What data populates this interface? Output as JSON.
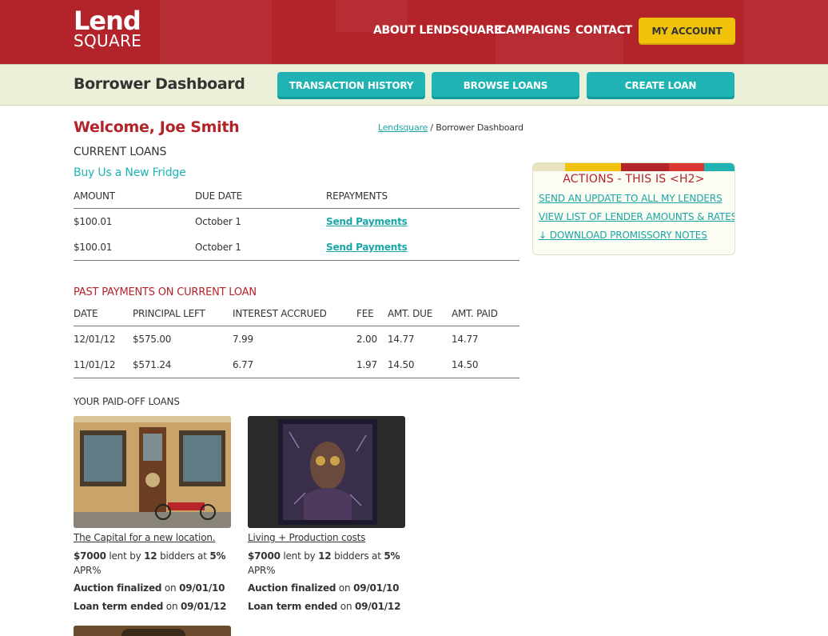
{
  "brand": {
    "logo_line1": "Lend",
    "logo_line2": "SQUARE"
  },
  "topnav": {
    "about": "ABOUT LENDSQUARE",
    "campaigns": "CAMPAIGNS",
    "contact": "CONTACT",
    "account": "MY ACCOUNT"
  },
  "subheader": {
    "title": "Borrower Dashboard",
    "btn_history": "TRANSACTION HISTORY",
    "btn_browse": "BROWSE LOANS",
    "btn_create": "CREATE LOAN"
  },
  "welcome": "Welcome, Joe Smith",
  "breadcrumb": {
    "home": "Lendsquare",
    "sep": " / ",
    "current": "Borrower Dashboard"
  },
  "current_loans": {
    "heading": "CURRENT LOANS",
    "loan_name": "Buy Us a New Fridge",
    "columns": [
      "AMOUNT",
      "DUE DATE",
      "REPAYMENTS"
    ],
    "rows": [
      {
        "amount": "$100.01",
        "due": "October 1",
        "action": "Send Payments"
      },
      {
        "amount": "$100.01",
        "due": "October 1",
        "action": "Send Payments"
      }
    ]
  },
  "past_payments": {
    "heading": "PAST PAYMENTS ON CURRENT LOAN",
    "columns": [
      "DATE",
      "PRINCIPAL LEFT",
      "INTEREST ACCRUED",
      "FEE",
      "AMT. DUE",
      "AMT. PAID"
    ],
    "rows": [
      {
        "date": "12/01/12",
        "principal": "$575.00",
        "interest": "7.99",
        "fee": "2.00",
        "due": "14.77",
        "paid": "14.77"
      },
      {
        "date": "11/01/12",
        "principal": "$571.24",
        "interest": "6.77",
        "fee": "1.97",
        "due": "14.50",
        "paid": "14.50"
      }
    ]
  },
  "actions": {
    "title": "ACTIONS - THIS IS <H2>",
    "items": [
      "SEND AN UPDATE TO ALL MY LENDERS",
      "VIEW LIST OF LENDER AMOUNTS & RATES",
      "DOWNLOAD PROMISSORY NOTES"
    ],
    "download_icon": "↓"
  },
  "paid_off": {
    "heading": "YOUR PAID-OFF LOANS",
    "cards": [
      {
        "title": "The Capital for a new location.",
        "amount": "$7000",
        "lent_by": " lent by ",
        "bidders": "12",
        "bidders_at": " bidders at ",
        "rate": "5%",
        "apr": "APR%",
        "auction_label": "Auction finalized",
        "on1": " on ",
        "auction_date": "09/01/10",
        "term_label": "Loan term ended",
        "on2": " on ",
        "term_date": "09/01/12"
      },
      {
        "title": "Living + Production costs",
        "amount": "$7000",
        "lent_by": " lent by ",
        "bidders": "12",
        "bidders_at": " bidders at ",
        "rate": "5%",
        "apr": "APR%",
        "auction_label": "Auction finalized",
        "on1": " on ",
        "auction_date": "09/01/10",
        "term_label": "Loan term ended",
        "on2": " on ",
        "term_date": "09/01/12"
      }
    ]
  },
  "colors": {
    "brand_red": "#b3232a",
    "teal": "#1fb3b3",
    "gold": "#f0c20a",
    "subbar": "#ecf0d8"
  }
}
